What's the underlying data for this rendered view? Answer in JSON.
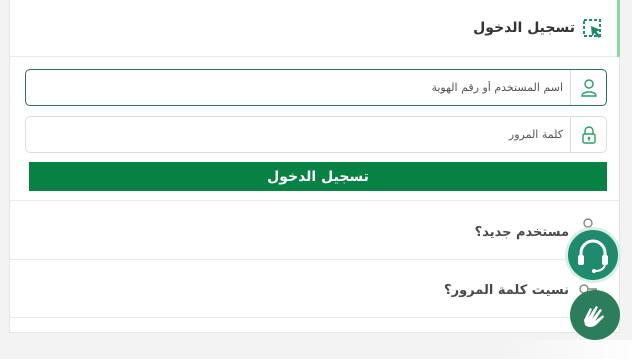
{
  "header": {
    "title": "تسجيل الدخول",
    "icon": "login-cursor-icon",
    "accent_color": "#078244"
  },
  "form": {
    "username": {
      "placeholder": "اسم المستخدم أو رقم الهوية",
      "value": "",
      "icon": "user-icon"
    },
    "password": {
      "placeholder": "كلمة المرور",
      "value": "",
      "icon": "lock-icon"
    },
    "submit_label": "تسجيل الدخول",
    "submit_color": "#078244"
  },
  "links": {
    "new_user": {
      "label": "مستخدم جديد؟",
      "icon": "add-user-icon"
    },
    "forgot_password": {
      "label": "نسيت كلمة المرور؟",
      "icon": "key-icon"
    }
  },
  "floating": {
    "support": {
      "icon": "headset-icon",
      "color": "#1f8a6d"
    },
    "accessibility": {
      "icon": "sign-language-icon",
      "color": "#2d7d5c"
    }
  }
}
